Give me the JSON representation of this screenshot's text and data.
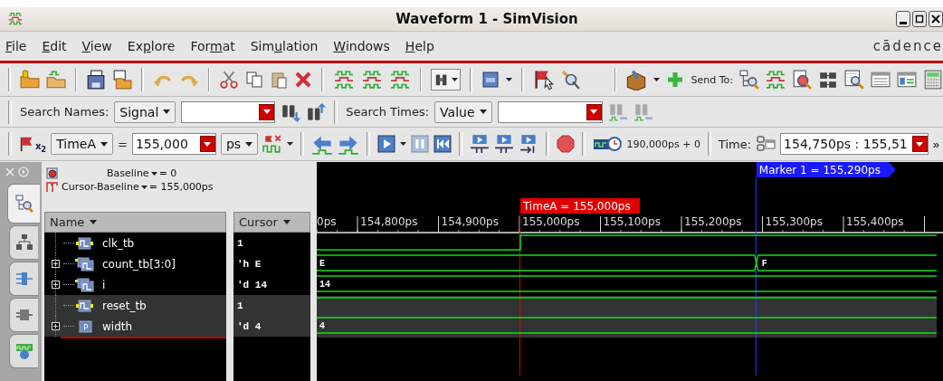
{
  "window": {
    "title": "Waveform 1 - SimVision"
  },
  "menu": [
    {
      "key": "F",
      "post": "ile"
    },
    {
      "key": "E",
      "post": "dit"
    },
    {
      "key": "V",
      "post": "iew"
    },
    {
      "pre": "Ex",
      "key": "p",
      "post": "lore"
    },
    {
      "pre": "For",
      "key": "m",
      "post": "at"
    },
    {
      "pre": "Sim",
      "key": "u",
      "post": "lation"
    },
    {
      "key": "W",
      "post": "indows"
    },
    {
      "key": "H",
      "post": "elp"
    }
  ],
  "brand": "cādence",
  "toolbar": {
    "send_to": "Send To:"
  },
  "search_bar": {
    "names_label": "Search Names:",
    "names_scope": "Signal",
    "times_label": "Search Times:",
    "times_scope": "Value"
  },
  "time_bar": {
    "flag_badge": "x$_{2}$",
    "cursor_name": "TimeA",
    "equals": "=",
    "time_value": "155,000",
    "unit": "ps",
    "sim_time": "190,000ps + 0",
    "time_label": "Time:",
    "time_range": "154,750ps : 155,51",
    "overflow": "»"
  },
  "side_tabs": [
    {
      "selected": true
    },
    {
      "selected": false
    },
    {
      "selected": false
    },
    {
      "selected": false
    },
    {
      "selected": false
    }
  ],
  "baseline": {
    "label": "Baseline",
    "value": "= 0"
  },
  "delta": {
    "label": "Cursor-Baseline",
    "value": "= 155,000ps"
  },
  "columns": [
    "Name",
    "Cursor"
  ],
  "signals": [
    {
      "name": "clk_tb",
      "kind": "signal",
      "expandable": false,
      "selected": false,
      "value": "1",
      "wave": {
        "kind": "bit",
        "high": [
          false,
          true
        ],
        "change_at_cursor": true
      }
    },
    {
      "name": "count_tb[3:0]",
      "kind": "bus",
      "expandable": true,
      "selected": false,
      "value": "'h E",
      "wave": {
        "kind": "bus",
        "values": [
          "E",
          "F"
        ],
        "change_at_marker": true
      }
    },
    {
      "name": "i",
      "kind": "bus",
      "expandable": true,
      "selected": false,
      "value": "'d 14",
      "wave": {
        "kind": "bus",
        "values": [
          "14"
        ]
      }
    },
    {
      "name": "reset_tb",
      "kind": "signal",
      "expandable": false,
      "selected": true,
      "value": "1",
      "wave": {
        "kind": "bit",
        "high": [
          true
        ]
      }
    },
    {
      "name": "width",
      "kind": "parameter",
      "icon_letter": "P",
      "expandable": true,
      "selected": true,
      "value": "'d 4",
      "wave": {
        "kind": "bus",
        "values": [
          "4"
        ]
      }
    }
  ],
  "ruler": {
    "ticks": [
      "0ps",
      "154,800ps",
      "154,900ps",
      "155,000ps",
      "155,100ps",
      "155,200ps",
      "155,300ps",
      "155,400ps"
    ],
    "cursor": {
      "label": "TimeA = 155,000ps",
      "level": 0.325
    },
    "marker": {
      "label": "Marker 1 = 155,290ps",
      "level": 0.702
    }
  }
}
